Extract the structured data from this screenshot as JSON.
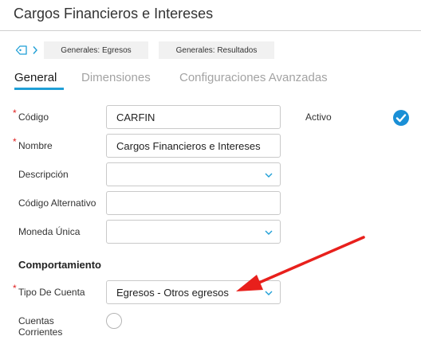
{
  "page": {
    "title": "Cargos Financieros e Intereses"
  },
  "breadcrumbs": [
    {
      "label": "Generales: Egresos"
    },
    {
      "label": "Generales: Resultados"
    }
  ],
  "tabs": [
    {
      "label": "General",
      "active": true
    },
    {
      "label": "Dimensiones",
      "active": false
    },
    {
      "label": "Configuraciones Avanzadas",
      "active": false
    }
  ],
  "form": {
    "codigo": {
      "label": "Código",
      "value": "CARFIN",
      "required": true
    },
    "nombre": {
      "label": "Nombre",
      "value": "Cargos Financieros e Intereses",
      "required": true
    },
    "descripcion": {
      "label": "Descripción",
      "value": ""
    },
    "codigo_alternativo": {
      "label": "Código Alternativo",
      "value": ""
    },
    "moneda_unica": {
      "label": "Moneda Única",
      "value": ""
    },
    "activo": {
      "label": "Activo",
      "checked": true
    },
    "comportamiento": {
      "label": "Comportamiento"
    },
    "tipo_de_cuenta": {
      "label": "Tipo De Cuenta",
      "value": "Egresos - Otros egresos",
      "required": true
    },
    "cuentas_corrientes": {
      "label_line1": "Cuentas",
      "label_line2": "Corrientes",
      "checked": false
    }
  },
  "colors": {
    "accent": "#1f9fd6",
    "check": "#1a8fd6",
    "required": "#e02020",
    "annotation_arrow": "#e8201c"
  }
}
